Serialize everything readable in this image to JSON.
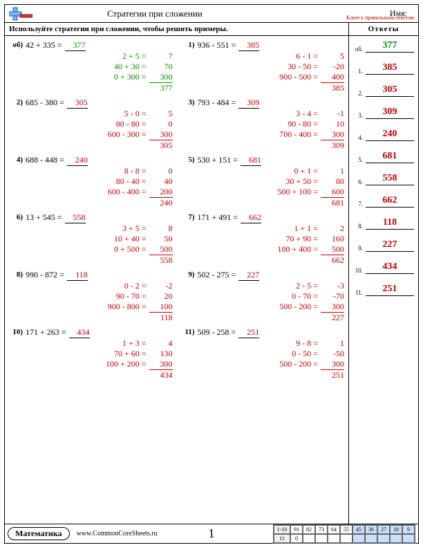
{
  "header": {
    "title": "Стратегии при сложении",
    "name_label": "Имя:",
    "answer_key": "Ключ к правильным ответам"
  },
  "instructions": "Используйте стратегии при сложении, чтобы решить примеры.",
  "answers_header": "Ответы",
  "problems": [
    {
      "num": "об)",
      "example": true,
      "expr": "42 + 335 =",
      "ans": "377",
      "steps": [
        [
          "2 +    5 =",
          "7"
        ],
        [
          "40 +  30 =",
          "70"
        ],
        [
          "0 + 300 =",
          "300"
        ]
      ],
      "total": "377"
    },
    {
      "num": "1)",
      "expr": "936 - 551 =",
      "ans": "385",
      "steps": [
        [
          "6 -    1 =",
          "5"
        ],
        [
          "30 -  50 =",
          "-20"
        ],
        [
          "900 - 500 =",
          "400"
        ]
      ],
      "total": "385"
    },
    {
      "num": "2)",
      "expr": "685 - 380 =",
      "ans": "305",
      "steps": [
        [
          "5 -    0 =",
          "5"
        ],
        [
          "80 -  80 =",
          "0"
        ],
        [
          "600 - 300 =",
          "300"
        ]
      ],
      "total": "305"
    },
    {
      "num": "3)",
      "expr": "793 - 484 =",
      "ans": "309",
      "steps": [
        [
          "3 -    4 =",
          "-1"
        ],
        [
          "90 -  80 =",
          "10"
        ],
        [
          "700 - 400 =",
          "300"
        ]
      ],
      "total": "309"
    },
    {
      "num": "4)",
      "expr": "688 - 448 =",
      "ans": "240",
      "steps": [
        [
          "8 -    8 =",
          "0"
        ],
        [
          "80 -  40 =",
          "40"
        ],
        [
          "600 - 400 =",
          "200"
        ]
      ],
      "total": "240"
    },
    {
      "num": "5)",
      "expr": "530 + 151 =",
      "ans": "681",
      "steps": [
        [
          "0 +    1 =",
          "1"
        ],
        [
          "30 +  50 =",
          "80"
        ],
        [
          "500 + 100 =",
          "600"
        ]
      ],
      "total": "681"
    },
    {
      "num": "6)",
      "expr": "13 + 545 =",
      "ans": "558",
      "steps": [
        [
          "3 +    5 =",
          "8"
        ],
        [
          "10 +  40 =",
          "50"
        ],
        [
          "0 + 500 =",
          "500"
        ]
      ],
      "total": "558"
    },
    {
      "num": "7)",
      "expr": "171 + 491 =",
      "ans": "662",
      "steps": [
        [
          "1 +    1 =",
          "2"
        ],
        [
          "70 +  90 =",
          "160"
        ],
        [
          "100 + 400 =",
          "500"
        ]
      ],
      "total": "662"
    },
    {
      "num": "8)",
      "expr": "990 - 872 =",
      "ans": "118",
      "steps": [
        [
          "0 -    2 =",
          "-2"
        ],
        [
          "90 -  70 =",
          "20"
        ],
        [
          "900 - 800 =",
          "100"
        ]
      ],
      "total": "118"
    },
    {
      "num": "9)",
      "expr": "502 - 275 =",
      "ans": "227",
      "steps": [
        [
          "2 -    5 =",
          "-3"
        ],
        [
          "0 -  70 =",
          "-70"
        ],
        [
          "500 - 200 =",
          "300"
        ]
      ],
      "total": "227"
    },
    {
      "num": "10)",
      "expr": "171 + 263 =",
      "ans": "434",
      "steps": [
        [
          "1 +    3 =",
          "4"
        ],
        [
          "70 +  60 =",
          "130"
        ],
        [
          "100 + 200 =",
          "300"
        ]
      ],
      "total": "434"
    },
    {
      "num": "11)",
      "expr": "509 - 258 =",
      "ans": "251",
      "steps": [
        [
          "9 -    8 =",
          "1"
        ],
        [
          "0 -  50 =",
          "-50"
        ],
        [
          "500 - 200 =",
          "300"
        ]
      ],
      "total": "251"
    }
  ],
  "answers": [
    {
      "n": "об.",
      "v": "377",
      "example": true
    },
    {
      "n": "1.",
      "v": "385"
    },
    {
      "n": "2.",
      "v": "305"
    },
    {
      "n": "3.",
      "v": "309"
    },
    {
      "n": "4.",
      "v": "240"
    },
    {
      "n": "5.",
      "v": "681"
    },
    {
      "n": "6.",
      "v": "558"
    },
    {
      "n": "7.",
      "v": "662"
    },
    {
      "n": "8.",
      "v": "118"
    },
    {
      "n": "9.",
      "v": "227"
    },
    {
      "n": "10.",
      "v": "434"
    },
    {
      "n": "11.",
      "v": "251"
    }
  ],
  "footer": {
    "subject": "Математика",
    "site": "www.CommonCoreSheets.ru",
    "page": "1",
    "score": {
      "row1_label": "1-10",
      "row2_label": "11",
      "row1": [
        "91",
        "82",
        "73",
        "64",
        "55",
        "45",
        "36",
        "27",
        "18",
        "9"
      ],
      "row2": [
        "0",
        "",
        "",
        "",
        "",
        "",
        "",
        "",
        "",
        ""
      ]
    }
  }
}
